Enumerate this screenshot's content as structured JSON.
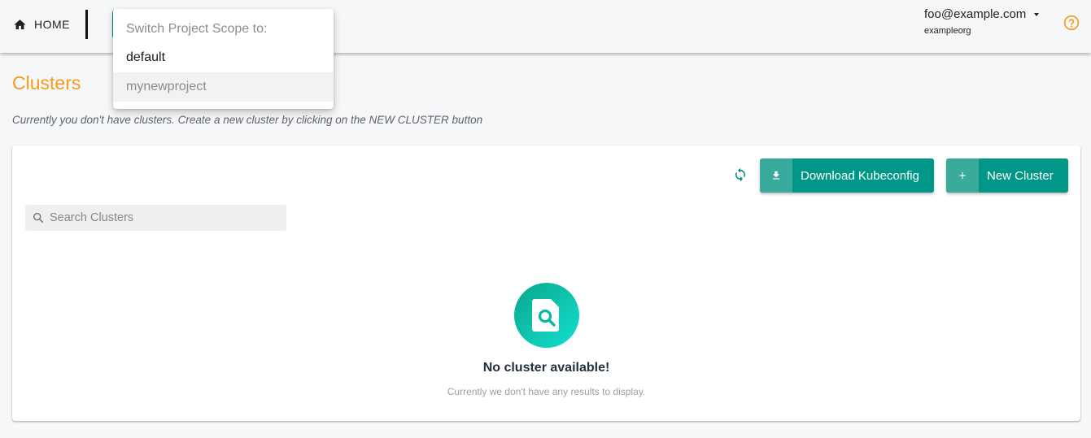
{
  "topbar": {
    "home_label": "HOME",
    "user_email": "foo@example.com",
    "user_org": "exampleorg",
    "help_icon": "help-circle-icon"
  },
  "project_dropdown": {
    "header": "Switch Project Scope to:",
    "options": [
      {
        "label": "default",
        "selected": true
      },
      {
        "label": "mynewproject",
        "selected": false,
        "hovered": true
      }
    ]
  },
  "page": {
    "title": "Clusters",
    "hint": "Currently you don't have clusters. Create a new cluster by clicking on the NEW CLUSTER button"
  },
  "toolbar": {
    "refresh_icon": "refresh-icon",
    "download_label": "Download Kubeconfig",
    "new_cluster_label": "New Cluster"
  },
  "search": {
    "placeholder": "Search Clusters",
    "value": ""
  },
  "empty_state": {
    "title": "No cluster available!",
    "subtitle": "Currently we don't have any results to display."
  },
  "colors": {
    "accent": "#009688",
    "title": "#f79a1c",
    "help": "#f79a1c"
  }
}
